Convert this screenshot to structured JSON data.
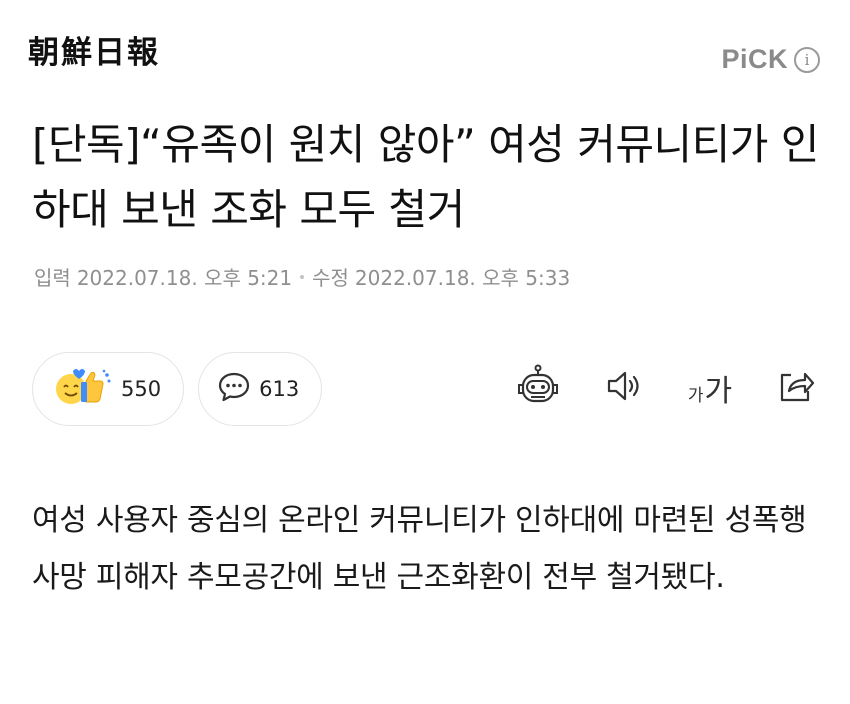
{
  "header": {
    "logo_text": "朝鮮日報",
    "pick_label": "PiCK",
    "info_symbol": "i"
  },
  "article": {
    "headline": "[단독]“유족이 원치 않아” 여성 커뮤니티가 인하대 보낸 조화 모두 철거",
    "input_label": "입력",
    "input_time": "2022.07.18. 오후 5:21",
    "edit_label": "수정",
    "edit_time": "2022.07.18. 오후 5:33",
    "body": "여성 사용자 중심의 온라인 커뮤니티가 인하대에 마련된 성폭행 사망 피해자 추모공간에 보낸 근조화환이 전부 철거됐다."
  },
  "reactions": {
    "like_count": "550",
    "comment_count": "613"
  },
  "toolbar": {
    "font_small": "가",
    "font_large": "가"
  },
  "icons": {
    "reaction": "smiley-thumbs-up-icon",
    "comment": "speech-bubble-icon",
    "summary": "robot-icon",
    "tts": "speaker-icon",
    "font": "font-size-icon",
    "share": "share-icon"
  },
  "colors": {
    "pick_gray": "#8a8a8a",
    "meta_gray": "#8f8f8f",
    "pill_border": "#e4e4e4",
    "emoji_yellow": "#ffd54a",
    "emoji_blue": "#3f8dfc"
  }
}
